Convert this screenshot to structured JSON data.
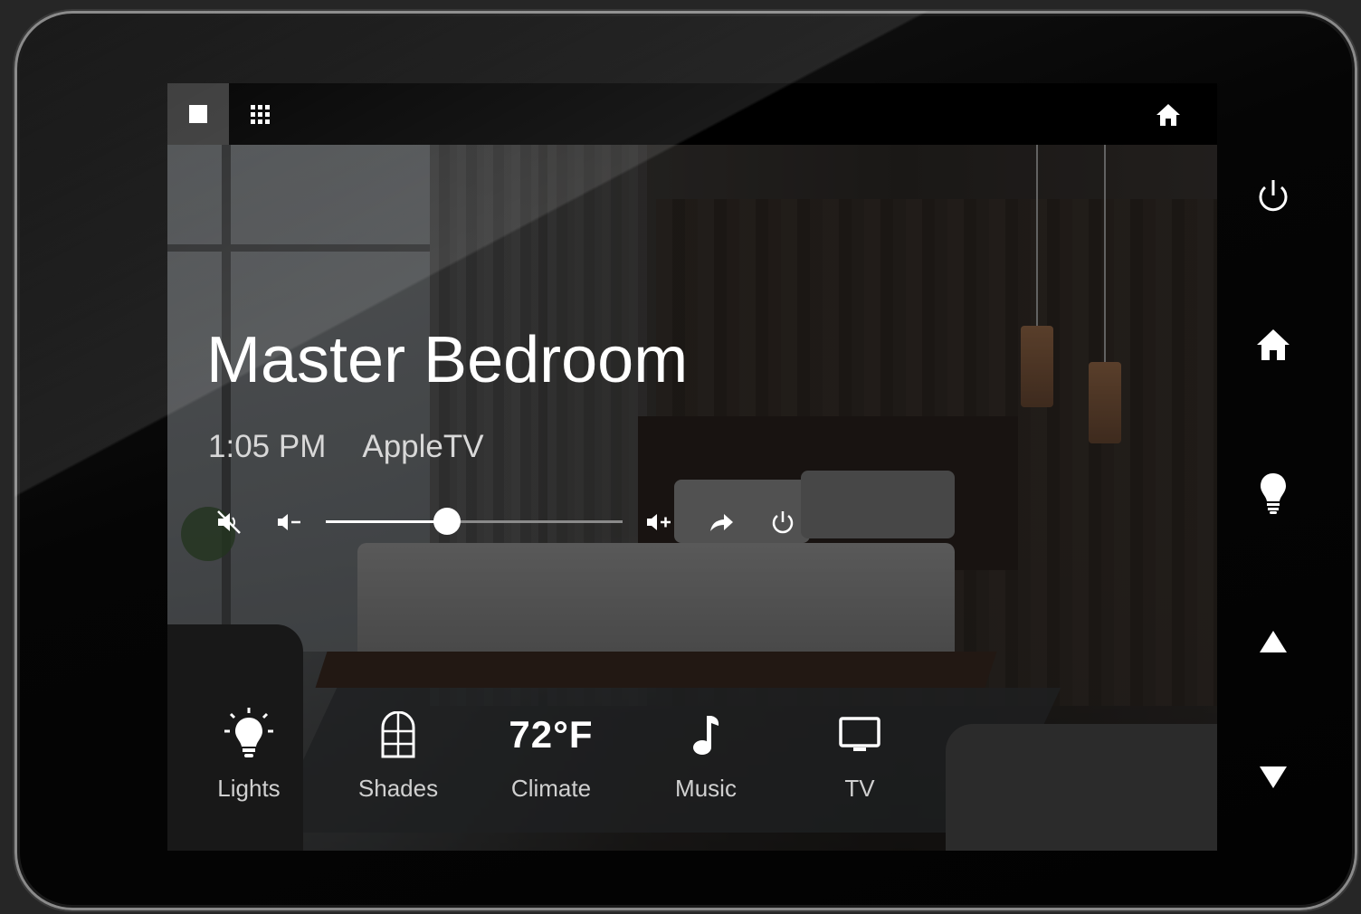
{
  "device": {
    "accent": "#ffffff",
    "bezel_color": "#050505"
  },
  "topbar": {
    "view_single_icon": "single-view-icon",
    "view_grid_icon": "grid-view-icon",
    "home_icon": "home-icon"
  },
  "room": {
    "name": "Master Bedroom",
    "time": "1:05 PM",
    "source": "AppleTV"
  },
  "volume": {
    "level": 0.41,
    "icons": [
      "mute-icon",
      "volume-down-icon",
      "volume-up-icon",
      "share-icon",
      "power-icon"
    ]
  },
  "nav": [
    {
      "label": "Lights",
      "icon": "lightbulb-icon"
    },
    {
      "label": "Shades",
      "icon": "shades-icon"
    },
    {
      "label": "Climate",
      "icon": "climate",
      "value": "72°F"
    },
    {
      "label": "Music",
      "icon": "music-note-icon"
    },
    {
      "label": "TV",
      "icon": "tv-icon"
    }
  ],
  "side_buttons": [
    "power-icon",
    "home-icon",
    "lightbulb-icon",
    "arrow-up-icon",
    "arrow-down-icon"
  ]
}
